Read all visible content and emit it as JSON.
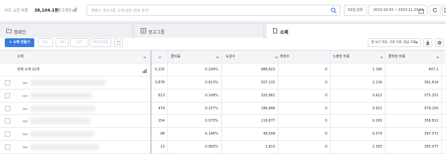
{
  "topbar": {
    "balance_label": "비즈 소진 비용",
    "balance_value": "38,104.1원",
    "account_label": "광고계정",
    "search_placeholder": "캠페인, 광고그룹, 소재 검색 (목표 일치)",
    "period_label": "52일 단위",
    "date_range": "2023-10-03 ~ 2023-11-23"
  },
  "tabs": [
    {
      "label": "캠페인"
    },
    {
      "label": "광고그룹"
    },
    {
      "label": "소재"
    }
  ],
  "toolbar": {
    "create_label": "+ 소재 만들기",
    "buttons": [
      "복사",
      "ON",
      "OFF",
      "예산의 조정"
    ],
    "columns_dropdown": "열 보기 지표, 기본 지표, 발급 지표"
  },
  "table": {
    "columns": [
      "소재",
      "클릭률",
      "도달수",
      "재생수",
      "노출당 비용",
      "클릭당 비용"
    ],
    "summary": {
      "label": "전체 소재 12개",
      "values": [
        "5,235",
        "0.294%",
        "988,823",
        "0",
        "1.195",
        "407.1"
      ]
    },
    "rows": [
      {
        "id": "1",
        "values": [
          "3,878",
          "0.613%",
          "507,215",
          "0",
          "2.216",
          "361.614"
        ]
      },
      {
        "id": "2",
        "values": [
          "613",
          "0.108%",
          "320,961",
          "0",
          "0.622",
          "575.251"
        ]
      },
      {
        "id": "3",
        "values": [
          "479",
          "0.157%",
          "186,846",
          "0",
          "0.911",
          "579.155"
        ]
      },
      {
        "id": "4",
        "values": [
          "154",
          "0.073%",
          "119,877",
          "0",
          "0.263",
          "358.812"
        ]
      },
      {
        "id": "5",
        "values": [
          "98",
          "0.146%",
          "48,599",
          "0",
          "0.579",
          "397.071"
        ]
      },
      {
        "id": "6",
        "values": [
          "13",
          "0.063%",
          "1,813",
          "0",
          "2.355",
          "355.077"
        ]
      }
    ]
  },
  "colors": {
    "accent": "#3b7ae0",
    "border": "#d7dbe0",
    "header_bg": "#f4f5f7"
  }
}
